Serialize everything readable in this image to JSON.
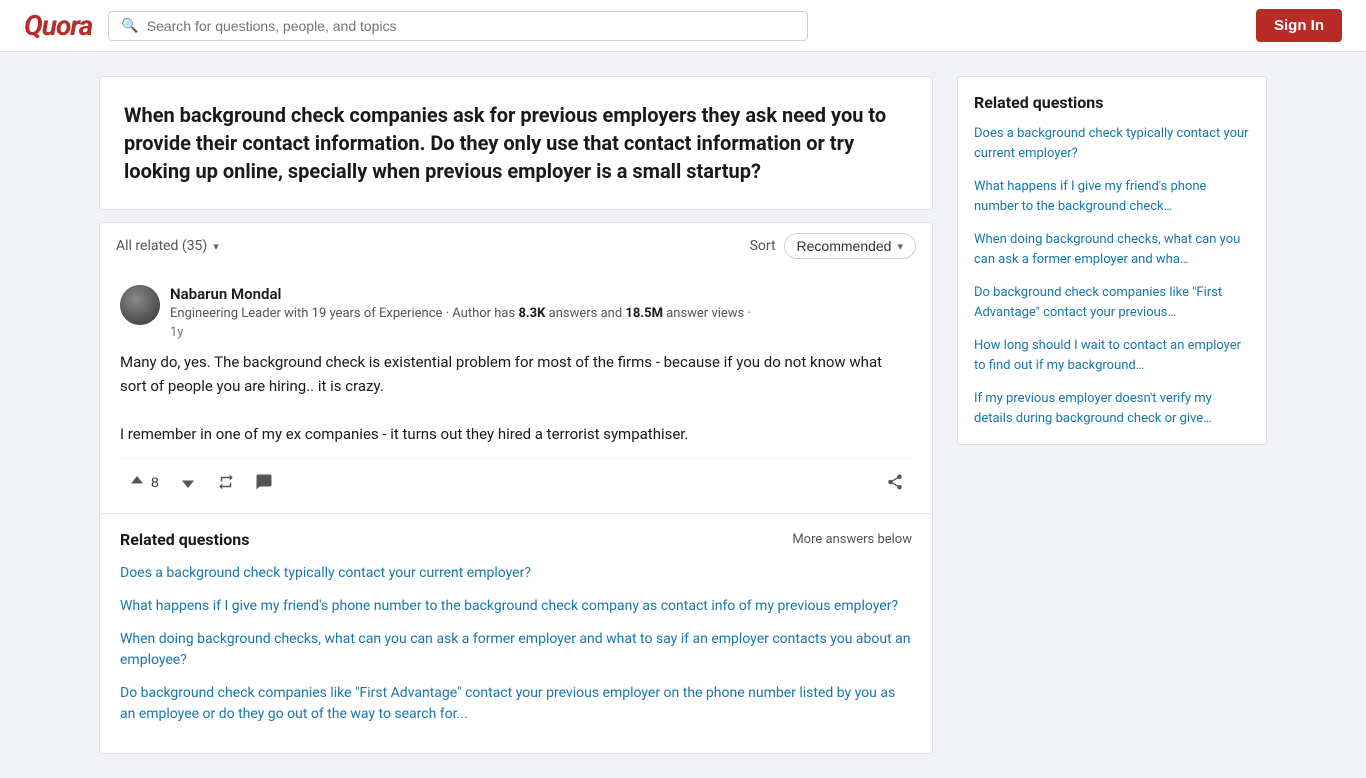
{
  "header": {
    "logo": "Quora",
    "search_placeholder": "Search for questions, people, and topics",
    "signin_label": "Sign In"
  },
  "question": {
    "title": "When background check companies ask for previous employers they ask need you to provide their contact information. Do they only use that contact information or try looking up online, specially when previous employer is a small startup?"
  },
  "sort_bar": {
    "all_related_label": "All related (35)",
    "sort_label": "Sort",
    "recommended_label": "Recommended"
  },
  "answer": {
    "author_name": "Nabarun Mondal",
    "author_bio": "Engineering Leader with 19 years of Experience · Author has",
    "author_answers": "8.3K",
    "author_bio_mid": "answers and",
    "author_views": "18.5M",
    "author_bio_end": "answer views ·",
    "author_time": "1y",
    "body_line1": "Many do, yes. The background check is existential problem for most of the firms - because if you do not know what sort of people you are hiring.. it is crazy.",
    "body_line2": "I remember in one of my ex companies - it turns out they hired a terrorist sympathiser.",
    "upvote_count": "8"
  },
  "related_main": {
    "title": "Related questions",
    "more_answers": "More answers below",
    "links": [
      "Does a background check typically contact your current employer?",
      "What happens if I give my friend's phone number to the background check company as contact info of my previous employer?",
      "When doing background checks, what can you can ask a former employer and what to say if an employer contacts you about an employee?",
      "Do background check companies like \"First Advantage\" contact your previous employer on the phone number listed by you as an employee or do they go out of the way to search for..."
    ]
  },
  "sidebar": {
    "title": "Related questions",
    "links": [
      "Does a background check typically contact your current employer?",
      "What happens if I give my friend's phone number to the background check…",
      "When doing background checks, what can you can ask a former employer and wha…",
      "Do background check companies like \"First Advantage\" contact your previous…",
      "How long should I wait to contact an employer to find out if my background…",
      "If my previous employer doesn't verify my details during background check or give…"
    ]
  },
  "icons": {
    "search": "🔍",
    "chevron_down": "▾",
    "upvote": "↑",
    "downvote": "↓",
    "retweet": "↺",
    "comment": "💬",
    "share": "↗"
  }
}
